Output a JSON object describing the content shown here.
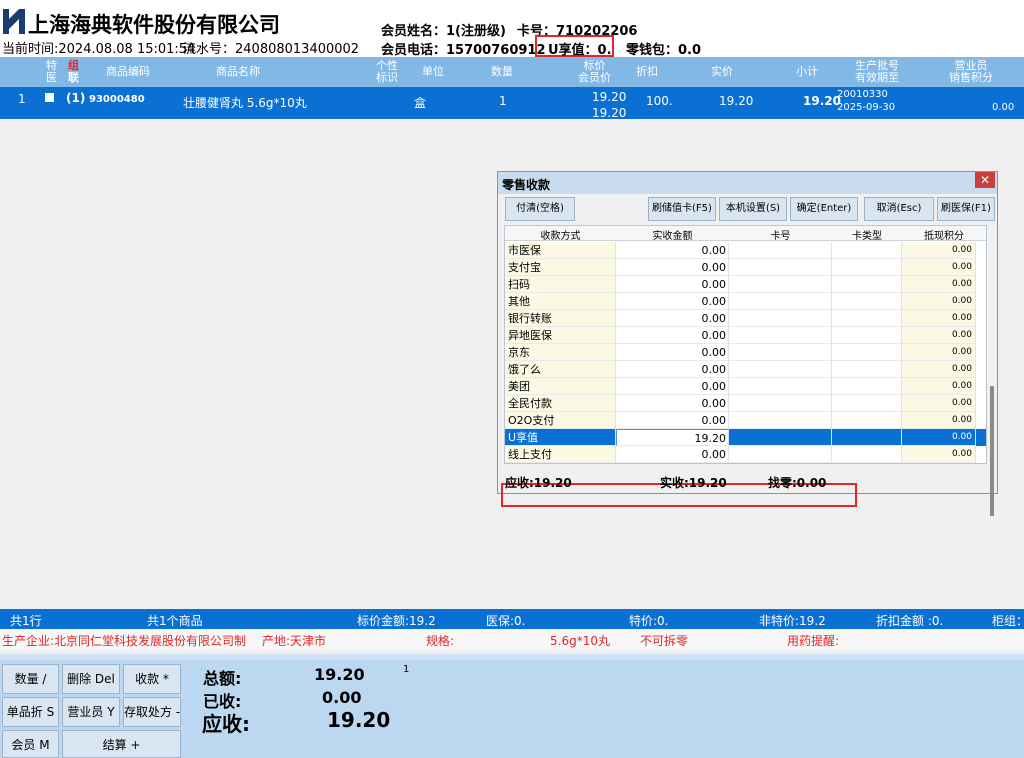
{
  "header": {
    "company": "上海海典软件股份有限公司",
    "current_time": "当前时间:2024.08.08 15:01:54",
    "serial": "流水号：240808013400002",
    "member_name": "会员姓名：1(注册级)",
    "card_no": "卡号：710202206",
    "member_phone": "会员电话：15700760912",
    "u_value": "U享值：0.",
    "wallet": "零钱包：0.0"
  },
  "grid": {
    "headers": {
      "special_1": "特",
      "special_2": "医",
      "group_1": "组",
      "group_2": "联",
      "code": "商品编码",
      "name": "商品名称",
      "tag_1": "个性",
      "tag_2": "标识",
      "unit": "单位",
      "qty": "数量",
      "price_1": "标价",
      "price_2": "会员价",
      "discount": "折扣",
      "actual": "实价",
      "subtotal": "小计",
      "batch_1": "生产批号",
      "batch_2": "有效期至",
      "sales_1": "营业员",
      "sales_2": "销售积分"
    },
    "row": {
      "index": "1",
      "group": "(1)",
      "code": "93000480",
      "name": "壮腰健肾丸  5.6g*10丸",
      "unit": "盒",
      "qty": "1",
      "price": "19.20",
      "member_price": "19.20",
      "discount": "100.",
      "actual": "19.20",
      "subtotal": "19.20",
      "batch": "20010330",
      "expiry": "2025-09-30",
      "points": "0.00"
    }
  },
  "dialog": {
    "title": "零售收款",
    "close": "✕",
    "buttons": {
      "clear": "付清(空格)",
      "card": "刷储值卡(F5)",
      "settings": "本机设置(S)",
      "confirm": "确定(Enter)",
      "cancel": "取消(Esc)",
      "insurance": "刷医保(F1)"
    },
    "columns": {
      "method": "收款方式",
      "amount": "实收金额",
      "card_no": "卡号",
      "card_type": "卡类型",
      "points": "抵现积分"
    },
    "rows": [
      {
        "method": "市医保",
        "amount": "0.00",
        "points": "0.00"
      },
      {
        "method": "支付宝",
        "amount": "0.00",
        "points": "0.00"
      },
      {
        "method": "扫码",
        "amount": "0.00",
        "points": "0.00"
      },
      {
        "method": "其他",
        "amount": "0.00",
        "points": "0.00"
      },
      {
        "method": "银行转账",
        "amount": "0.00",
        "points": "0.00"
      },
      {
        "method": "异地医保",
        "amount": "0.00",
        "points": "0.00"
      },
      {
        "method": "京东",
        "amount": "0.00",
        "points": "0.00"
      },
      {
        "method": "饿了么",
        "amount": "0.00",
        "points": "0.00"
      },
      {
        "method": "美团",
        "amount": "0.00",
        "points": "0.00"
      },
      {
        "method": "全民付款",
        "amount": "0.00",
        "points": "0.00"
      },
      {
        "method": "O2O支付",
        "amount": "0.00",
        "points": "0.00"
      },
      {
        "method": "U享值",
        "amount": "19.20",
        "points": "0.00"
      },
      {
        "method": "线上支付",
        "amount": "0.00",
        "points": "0.00"
      }
    ],
    "footer": {
      "due": "应收:19.20",
      "received": "实收:19.20",
      "change": "找零:0.00"
    }
  },
  "status": {
    "rows": "共1行",
    "items": "共1个商品",
    "list_total": "标价金额:19.2",
    "insurance": "医保:0.",
    "special": "特价:0.",
    "non_special": "非特价:19.2",
    "discount_total": "折扣金额 :0.",
    "counter": "柜组：",
    "manufacturer": "生产企业:北京同仁堂科技发展股份有限公司制药",
    "origin": "产地:天津市",
    "spec_label": "规格:",
    "spec_value": "5.6g*10丸",
    "split": "不可拆零",
    "reminder": "用药提醒:"
  },
  "bottom": {
    "buttons": {
      "qty": "数量 /",
      "delete": "删除 Del",
      "collect": "收款 *",
      "item_discount": "单品折 S",
      "clerk": "营业员 Y",
      "prescription": "存取处方 -",
      "member": "会员 M",
      "settle": "结算 +"
    },
    "total_label": "总额:",
    "total_value": "19.20",
    "paid_label": "已收:",
    "paid_value": "0.00",
    "due_label": "应收:",
    "due_value": "19.20",
    "badge": "1"
  }
}
